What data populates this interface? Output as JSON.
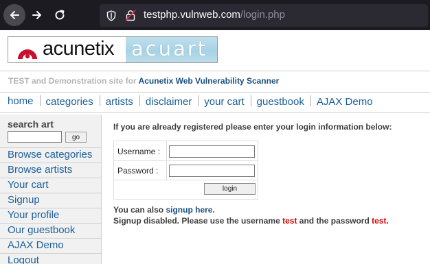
{
  "browser": {
    "url_host": "testphp.vulnweb.com",
    "url_path": "/login.php"
  },
  "logo": {
    "left_text": "acunetix",
    "right_text": "acuart"
  },
  "tagline": {
    "prefix": "TEST and Demonstration site for ",
    "brand": "Acunetix Web Vulnerability Scanner"
  },
  "menu": [
    {
      "label": "home"
    },
    {
      "label": "categories"
    },
    {
      "label": "artists"
    },
    {
      "label": "disclaimer"
    },
    {
      "label": "your cart"
    },
    {
      "label": "guestbook"
    },
    {
      "label": "AJAX Demo"
    }
  ],
  "sidebar": {
    "search_title": "search art",
    "go_label": "go",
    "links": [
      {
        "label": "Browse categories"
      },
      {
        "label": "Browse artists"
      },
      {
        "label": "Your cart"
      },
      {
        "label": "Signup"
      },
      {
        "label": "Your profile"
      },
      {
        "label": "Our guestbook"
      },
      {
        "label": "AJAX Demo"
      },
      {
        "label": "Logout"
      }
    ]
  },
  "login": {
    "heading": "If you are already registered please enter your login information below:",
    "username_label": "Username :",
    "password_label": "Password :",
    "button_label": "login"
  },
  "signup": {
    "prefix": "You can also ",
    "link": "signup here",
    "suffix": "."
  },
  "disabled": {
    "part1": "Signup disabled. Please use the username ",
    "username": "test",
    "part2": " and the password ",
    "password": "test",
    "part3": "."
  },
  "colors": {
    "chrome_bg": "#1c1b22",
    "urlbar_bg": "#2b2a33",
    "link_blue": "#1a5f9a",
    "brand_blue": "#1a4f80",
    "credential_red": "#d40000",
    "logo_red": "#c8102e",
    "acuart_blue": "#a7d2e5"
  },
  "icons": {
    "back": "arrow-left-icon",
    "forward": "arrow-right-icon",
    "reload": "reload-icon",
    "shield": "shield-icon",
    "insecure": "insecure-lock-icon",
    "logo": "acunetix-logo-icon"
  }
}
